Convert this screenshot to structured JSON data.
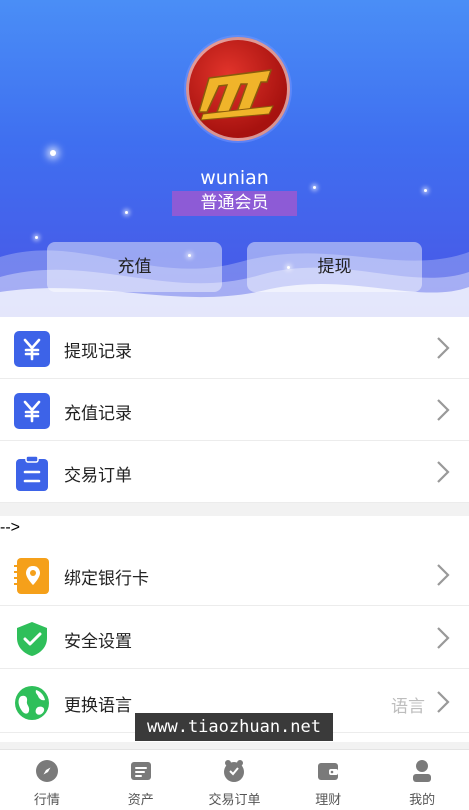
{
  "profile": {
    "username": "wunian",
    "member_level": "普通会员",
    "recharge_label": "充值",
    "withdraw_label": "提现"
  },
  "menu_group1": [
    {
      "label": "提现记录",
      "icon": "yuan-icon"
    },
    {
      "label": "充值记录",
      "icon": "yuan-icon"
    },
    {
      "label": "交易订单",
      "icon": "clipboard-icon"
    }
  ],
  "stray_text": "-->",
  "menu_group2": [
    {
      "label": "绑定银行卡",
      "icon": "bank-card-location-icon"
    },
    {
      "label": "安全设置",
      "icon": "shield-check-icon"
    },
    {
      "label": "更换语言",
      "icon": "globe-icon",
      "value": "语言"
    }
  ],
  "watermark": "www.tiaozhuan.net",
  "tabs": [
    {
      "label": "行情",
      "icon": "compass-icon"
    },
    {
      "label": "资产",
      "icon": "wallet-card-icon"
    },
    {
      "label": "交易订单",
      "icon": "orders-icon"
    },
    {
      "label": "理财",
      "icon": "purse-icon"
    },
    {
      "label": "我的",
      "icon": "user-icon"
    }
  ],
  "colors": {
    "header_top": "#4a8ef6",
    "header_bottom": "#4a55e6",
    "badge": "#8d5bd6",
    "icon_blue": "#3d63e8",
    "icon_orange": "#f5a01a",
    "icon_green": "#2fbf5a"
  }
}
